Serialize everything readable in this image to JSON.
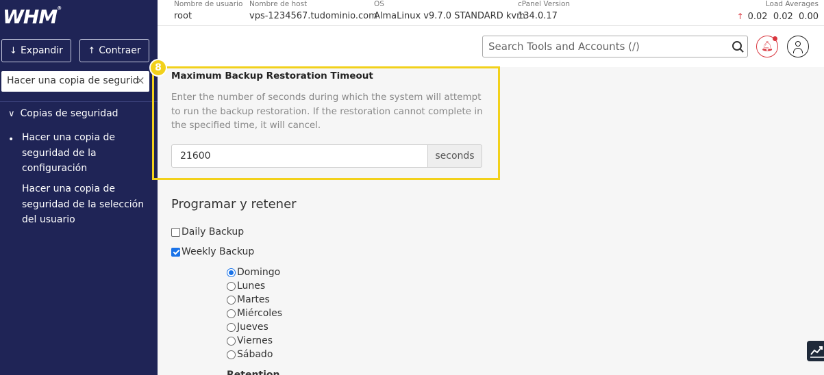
{
  "sidebar": {
    "logo": "WHM",
    "logo_mark": "®",
    "expand_label": "Expandir",
    "collapse_label": "Contraer",
    "search_value": "Hacer una copia de segurid",
    "category": "Copias de seguridad",
    "items": [
      {
        "label": "Hacer una copia de seguridad de la configuración",
        "active": true
      },
      {
        "label": "Hacer una copia de seguridad de la selección del usuario",
        "active": false
      }
    ]
  },
  "infobar": {
    "username": {
      "label": "Nombre de usuario",
      "value": "root"
    },
    "hostname": {
      "label": "Nombre de host",
      "value": "vps-1234567.tudominio.com"
    },
    "os": {
      "label": "OS",
      "value": "AlmaLinux v9.7.0 STANDARD kvm"
    },
    "cpanel": {
      "label": "cPanel Version",
      "value": "134.0.17"
    },
    "load": {
      "label": "Load Averages",
      "values": "0.02  0.02  0.00"
    }
  },
  "header": {
    "search_placeholder": "Search Tools and Accounts (/)"
  },
  "timeout_field": {
    "step_badge": "8",
    "title": "Maximum Backup Restoration Timeout",
    "description": "Enter the number of seconds during which the system will attempt to run the backup restoration. If the restoration cannot complete in the specified time, it will cancel.",
    "value": "21600",
    "unit": "seconds"
  },
  "schedule": {
    "title": "Programar y retener",
    "daily_label": "Daily Backup",
    "daily_checked": false,
    "weekly_label": "Weekly Backup",
    "weekly_checked": true,
    "days": [
      {
        "label": "Domingo",
        "checked": true
      },
      {
        "label": "Lunes",
        "checked": false
      },
      {
        "label": "Martes",
        "checked": false
      },
      {
        "label": "Miércoles",
        "checked": false
      },
      {
        "label": "Jueves",
        "checked": false
      },
      {
        "label": "Viernes",
        "checked": false
      },
      {
        "label": "Sábado",
        "checked": false
      }
    ],
    "retention_label": "Retention"
  },
  "colors": {
    "sidebar_bg": "#1f2456",
    "highlight": "#f2d11b",
    "accent": "#1a73e8",
    "alert": "#d9363e"
  }
}
